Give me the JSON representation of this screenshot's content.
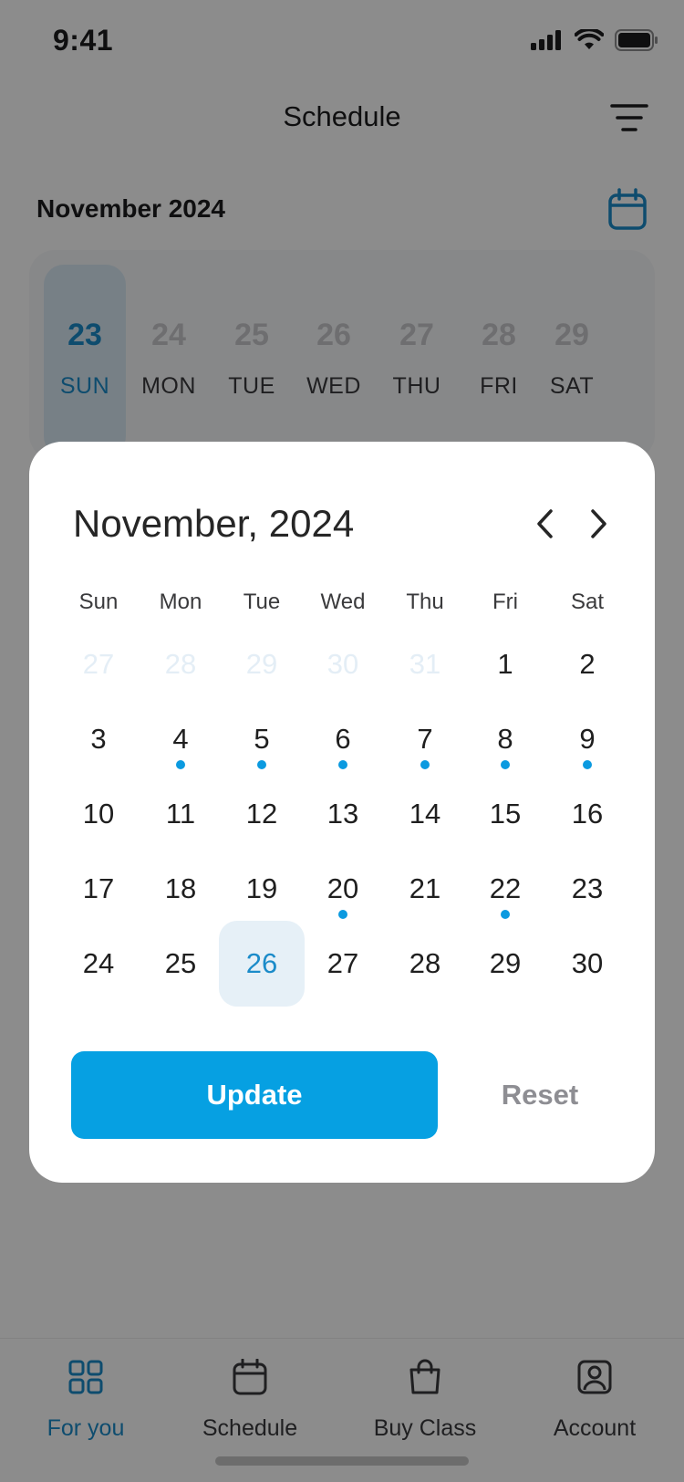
{
  "status_bar": {
    "time": "9:41"
  },
  "header": {
    "title": "Schedule",
    "filter_icon": "filter-icon"
  },
  "month_bar": {
    "label": "November 2024",
    "calendar_icon": "calendar-icon"
  },
  "week_strip": {
    "days": [
      {
        "num": "23",
        "name": "SUN",
        "selected": true
      },
      {
        "num": "24",
        "name": "MON",
        "selected": false
      },
      {
        "num": "25",
        "name": "TUE",
        "selected": false
      },
      {
        "num": "26",
        "name": "WED",
        "selected": false
      },
      {
        "num": "27",
        "name": "THU",
        "selected": false
      },
      {
        "num": "28",
        "name": "FRI",
        "selected": false
      },
      {
        "num": "29",
        "name": "SAT",
        "selected": false
      }
    ]
  },
  "date_picker": {
    "title": "November, 2024",
    "prev_icon": "chevron-left-icon",
    "next_icon": "chevron-right-icon",
    "weekdays": [
      "Sun",
      "Mon",
      "Tue",
      "Wed",
      "Thu",
      "Fri",
      "Sat"
    ],
    "weeks": [
      [
        {
          "label": "27",
          "muted": true
        },
        {
          "label": "28",
          "muted": true
        },
        {
          "label": "29",
          "muted": true
        },
        {
          "label": "30",
          "muted": true
        },
        {
          "label": "31",
          "muted": true
        },
        {
          "label": "1"
        },
        {
          "label": "2"
        }
      ],
      [
        {
          "label": "3"
        },
        {
          "label": "4",
          "event": true
        },
        {
          "label": "5",
          "event": true
        },
        {
          "label": "6",
          "event": true
        },
        {
          "label": "7",
          "event": true
        },
        {
          "label": "8",
          "event": true
        },
        {
          "label": "9",
          "event": true
        }
      ],
      [
        {
          "label": "10"
        },
        {
          "label": "11"
        },
        {
          "label": "12"
        },
        {
          "label": "13"
        },
        {
          "label": "14"
        },
        {
          "label": "15"
        },
        {
          "label": "16"
        }
      ],
      [
        {
          "label": "17"
        },
        {
          "label": "18"
        },
        {
          "label": "19"
        },
        {
          "label": "20",
          "event": true
        },
        {
          "label": "21"
        },
        {
          "label": "22",
          "event": true
        },
        {
          "label": "23"
        }
      ],
      [
        {
          "label": "24"
        },
        {
          "label": "25"
        },
        {
          "label": "26",
          "selected": true
        },
        {
          "label": "27"
        },
        {
          "label": "28"
        },
        {
          "label": "29"
        },
        {
          "label": "30"
        }
      ]
    ],
    "update_label": "Update",
    "reset_label": "Reset"
  },
  "tab_bar": {
    "tabs": [
      {
        "label": "For you",
        "icon": "grid-icon",
        "active": true
      },
      {
        "label": "Schedule",
        "icon": "calendar-icon",
        "active": false
      },
      {
        "label": "Buy Class",
        "icon": "shopping-bag-icon",
        "active": false
      },
      {
        "label": "Account",
        "icon": "user-icon",
        "active": false
      }
    ]
  },
  "colors": {
    "accent": "#06a0e2",
    "selected_text": "#1b8bc9",
    "event_dot": "#0b9ae0",
    "scrim": "rgba(0,0,0,0.45)"
  }
}
